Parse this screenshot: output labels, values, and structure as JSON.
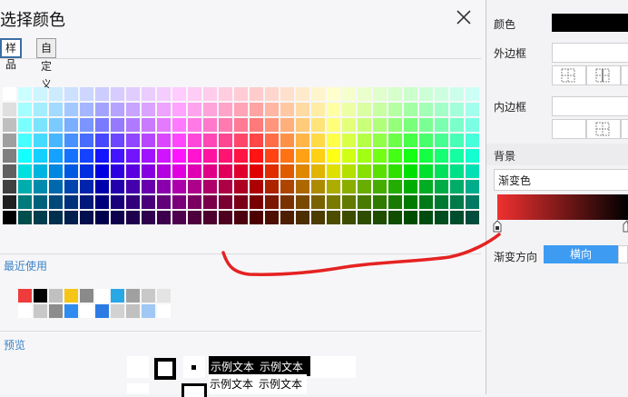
{
  "dialog": {
    "title": "选择颜色",
    "tabs": [
      {
        "label": "样品",
        "active": true
      },
      {
        "label": "自定义",
        "active": false
      }
    ],
    "recent_label": "最近使用",
    "preview_label": "预览",
    "preview_text": "示例文本",
    "recent_colors": [
      [
        "#ee3b3b",
        "#000000",
        "#c0c0c0",
        "#f5c518",
        "#8a8a8a",
        "#ffffff",
        "#29a8e6",
        "#a0a0a0",
        "#c8c8c8",
        "#e4e4e4"
      ],
      [
        "#ffffff",
        "#c8c8c8",
        "#8c8c8c",
        "#2e8cf0",
        "#ffffff",
        "#2c7be5",
        "#d2d2d2",
        "#c0c0c0",
        "#9fc8f5",
        "#ffffff"
      ]
    ]
  },
  "sidebar": {
    "color_label": "颜色",
    "color_value": "#000000",
    "outer_border_label": "外边框",
    "inner_border_label": "内边框",
    "background_label": "背景",
    "fill_type": "渐变色",
    "gradient": {
      "start": "#f03030",
      "end": "#000000"
    },
    "direction_label": "渐变方向",
    "direction_value": "横向"
  },
  "colors": {
    "accent": "#3d9bf2",
    "section_label": "#3d84c6",
    "annotation_stroke": "#e52222"
  }
}
